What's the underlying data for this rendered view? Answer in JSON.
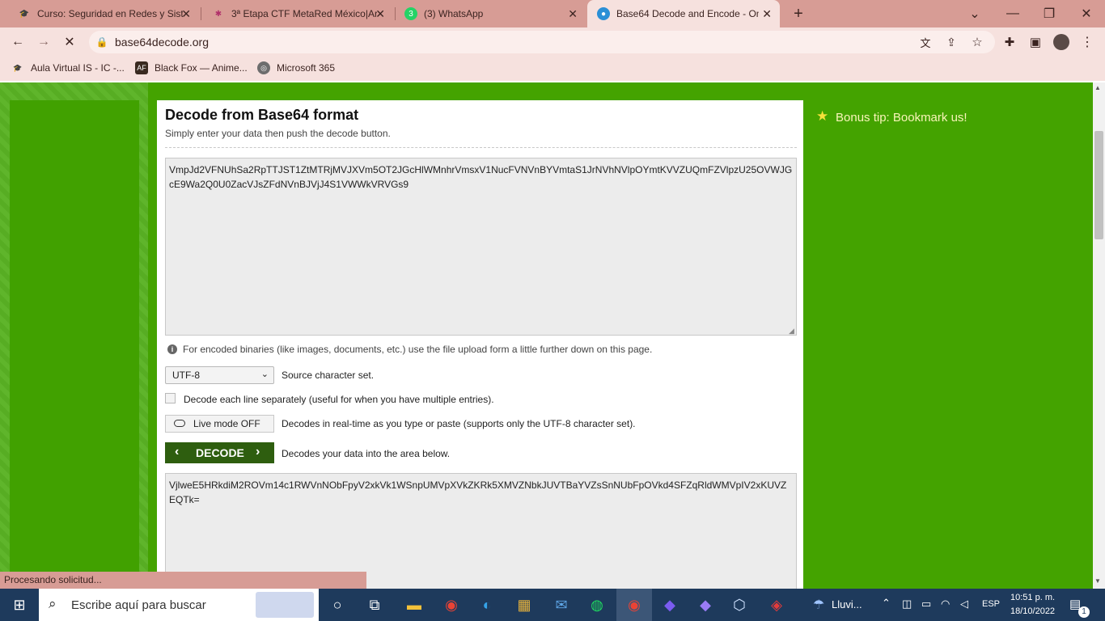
{
  "browser": {
    "tabs": [
      {
        "title": "Curso: Seguridad en Redes y Sist",
        "icon": "moodle-icon"
      },
      {
        "title": "3ª Etapa CTF MetaRed México|Ar",
        "icon": "slack-icon"
      },
      {
        "title": "(3) WhatsApp",
        "icon": "whatsapp-icon"
      },
      {
        "title": "Base64 Decode and Encode - On",
        "icon": "base64-icon"
      }
    ],
    "new_tab": "+",
    "url": "base64decode.org",
    "bookmarks": [
      {
        "label": "Aula Virtual IS - IC -..."
      },
      {
        "label": "Black Fox — Anime..."
      },
      {
        "label": "Microsoft 365"
      }
    ]
  },
  "page": {
    "heading": "Decode from Base64 format",
    "subheading": "Simply enter your data then push the decode button.",
    "input_text": "VmpJd2VFNUhSa2RpTTJST1ZtMTRjMVJXVm5OT2JGcHlWMnhrVmsxV1NucFVNVnBYVmtaS1JrNVhNVlpOYmtKVVZUQmFZVlpzU25OVWJGcE9Wa2Q0U0ZacVJsZFdNVnBJVjJ4S1VWWkVRVGs9",
    "info_text": "For encoded binaries (like images, documents, etc.) use the file upload form a little further down on this page.",
    "charset_value": "UTF-8",
    "charset_label": "Source character set.",
    "each_line_label": "Decode each line separately (useful for when you have multiple entries).",
    "live_mode_label": "Live mode OFF",
    "live_mode_desc": "Decodes in real-time as you type or paste (supports only the UTF-8 character set).",
    "decode_label": "DECODE",
    "decode_desc": "Decodes your data into the area below.",
    "output_text": "VjlweE5HRkdiM2ROVm14c1RWVnNObFpyV2xkVk1WSnpUMVpXVkZKRk5XMVZNbkJUVTBaYVZsSnNUbFpOVkd4SFZqRldWMVpIV2xKUVZEQTk=",
    "bonus_tip": "Bonus tip: Bookmark us!"
  },
  "status_text": "Procesando solicitud...",
  "taskbar": {
    "search_placeholder": "Escribe aquí para buscar",
    "weather": "Lluvi...",
    "language": "ESP",
    "time": "10:51 p. m.",
    "date": "18/10/2022",
    "notification_count": "1"
  },
  "colors": {
    "accent_green": "#44a300",
    "decode_button": "#2e5e0f",
    "browser_chrome": "#d79c95"
  }
}
